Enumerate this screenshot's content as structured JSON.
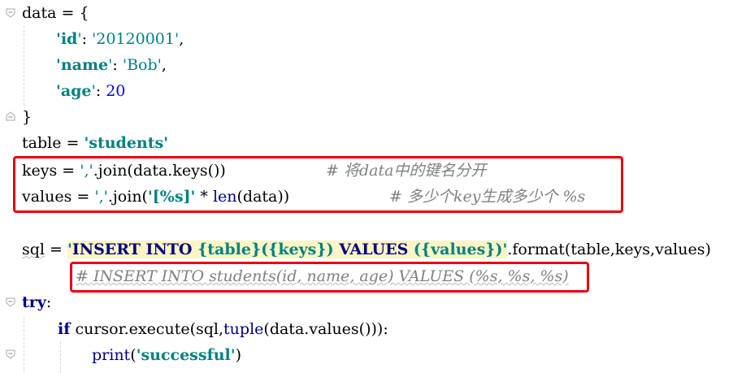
{
  "editor": {
    "line1": {
      "a": "data = {"
    },
    "line2": {
      "q1": "'",
      "key": "id",
      "q2": "'",
      "colon": ": ",
      "val": "'20120001'",
      "comma": ","
    },
    "line3": {
      "q1": "'",
      "key": "name",
      "q2": "'",
      "colon": ": ",
      "val": "'Bob'",
      "comma": ","
    },
    "line4": {
      "q1": "'",
      "key": "age",
      "q2": "'",
      "colon": ": ",
      "num": "20"
    },
    "line5": {
      "a": "}"
    },
    "line6": {
      "a": "table = ",
      "str": "'students'"
    },
    "line7": {
      "a": "keys = ",
      "str": "','",
      "b": ".join(data.keys())",
      "comment": "# 将data中的键名分开"
    },
    "line8": {
      "a": "values = ",
      "str": "','",
      "b": ".join(",
      "str2": "'[%s]'",
      "c": " * ",
      "len": "len",
      "d": "(data))",
      "comment": "# 多少个key生成多少个 %s"
    },
    "line9": {
      "a": "sql",
      "b": " = ",
      "q1": "'",
      "sql1": "INSERT INTO ",
      "p1": "{table}({keys}) ",
      "sql2": "VALUES ",
      "p2": "({values})",
      "q2": "'",
      "c": ".format(table,keys,values)"
    },
    "line10": {
      "comment": "# INSERT INTO students(id, name, age) VALUES (%s, %s, %s)"
    },
    "line11": {
      "kw": "try",
      "a": ":"
    },
    "line12": {
      "kw": "if",
      "a": " cursor.execute(sql,",
      "builtin": "tuple",
      "b": "(data.values())):"
    },
    "line13": {
      "builtin": "print",
      "a": "(",
      "str": "'successful'",
      "b": ")"
    }
  },
  "colors": {
    "keyword": "#000080",
    "string": "#008080",
    "number": "#0000ff",
    "comment": "#808080",
    "highlight": "#fdf5c5",
    "annotation_box": "#e8000d"
  },
  "icons": [
    "fold-open-icon",
    "fold-close-icon"
  ]
}
